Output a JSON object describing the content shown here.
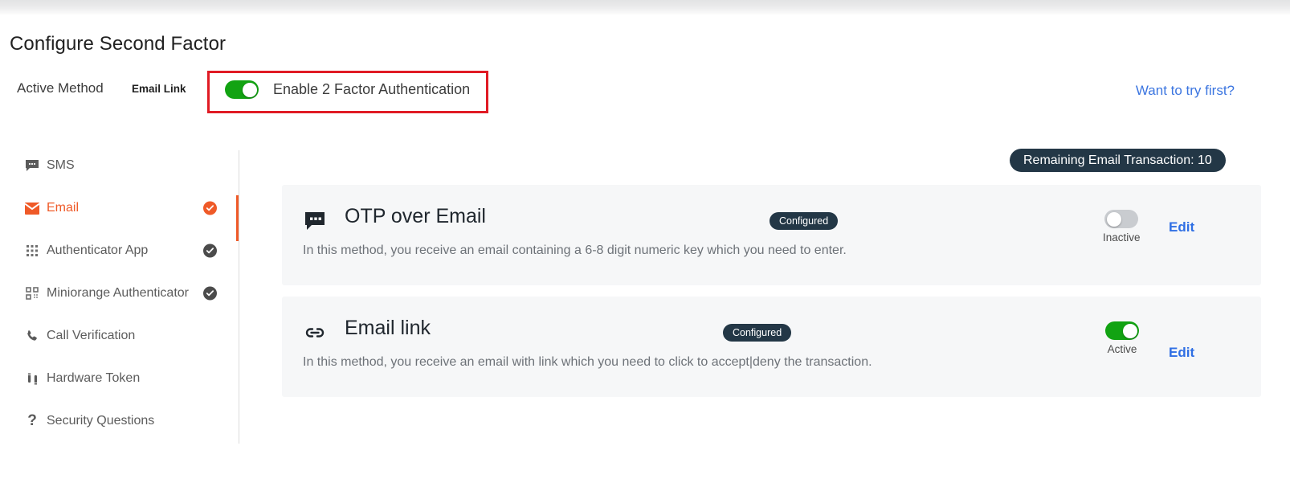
{
  "page": {
    "title": "Configure Second Factor"
  },
  "active_method": {
    "label": "Active Method",
    "value": "Email Link",
    "enable_toggle_label": "Enable 2 Factor Authentication",
    "enable_toggle_on": true,
    "try_link": "Want to try first?",
    "highlight_color": "#e01b24",
    "toggle_on_color": "#12a312",
    "link_color": "#3b75e0"
  },
  "sidebar": {
    "active_color": "#ef5a28",
    "items": [
      {
        "label": "SMS",
        "icon": "sms-bubble-icon",
        "active": false,
        "badge": "none"
      },
      {
        "label": "Email",
        "icon": "envelope-icon",
        "active": true,
        "badge": "orange-check"
      },
      {
        "label": "Authenticator App",
        "icon": "grid-dots-icon",
        "active": false,
        "badge": "gray-check"
      },
      {
        "label": "Miniorange Authenticator",
        "icon": "qr-code-icon",
        "active": false,
        "badge": "gray-check"
      },
      {
        "label": "Call Verification",
        "icon": "phone-icon",
        "active": false,
        "badge": "none"
      },
      {
        "label": "Hardware Token",
        "icon": "hardware-token-icon",
        "active": false,
        "badge": "none"
      },
      {
        "label": "Security Questions",
        "icon": "question-mark-icon",
        "active": false,
        "badge": "none"
      }
    ]
  },
  "remaining_badge": {
    "text": "Remaining Email Transaction: 10",
    "background": "#233746"
  },
  "methods": [
    {
      "title": "OTP over Email",
      "icon": "chat-dots-icon",
      "chip": "Configured",
      "description": "In this method, you receive an email containing a 6-8 digit numeric key which you need to enter.",
      "toggle_on": false,
      "toggle_state": "Inactive",
      "edit_label": "Edit"
    },
    {
      "title": "Email link",
      "icon": "chain-link-icon",
      "chip": "Configured",
      "description": "In this method, you receive an email with link which you need to click to accept|deny the transaction.",
      "toggle_on": true,
      "toggle_state": "Active",
      "edit_label": "Edit"
    }
  ]
}
